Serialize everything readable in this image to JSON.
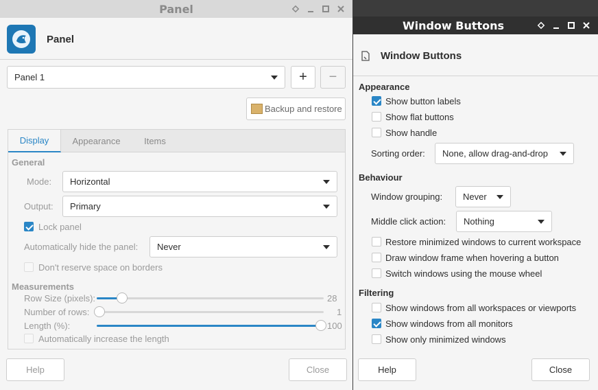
{
  "panel_window": {
    "title": "Panel",
    "header_title": "Panel",
    "panel_select": "Panel 1",
    "add_label": "+",
    "remove_label": "−",
    "backup_label": "Backup and restore",
    "tabs": [
      {
        "label": "Display",
        "active": true
      },
      {
        "label": "Appearance",
        "active": false
      },
      {
        "label": "Items",
        "active": false
      }
    ],
    "general": {
      "heading": "General",
      "mode_label": "Mode:",
      "mode_value": "Horizontal",
      "output_label": "Output:",
      "output_value": "Primary",
      "lock_panel": {
        "label": "Lock panel",
        "checked": true
      },
      "autohide_label": "Automatically hide the panel:",
      "autohide_value": "Never",
      "reserve_space": {
        "label": "Don't reserve space on borders",
        "checked": false
      }
    },
    "measurements": {
      "heading": "Measurements",
      "row_size_label": "Row Size (pixels):",
      "row_size_value": "28",
      "rows_label": "Number of rows:",
      "rows_value": "1",
      "length_label": "Length (%):",
      "length_value": "100",
      "auto_length": {
        "label": "Automatically increase the length",
        "checked": false
      }
    },
    "help_label": "Help",
    "close_label": "Close"
  },
  "wb_window": {
    "title": "Window Buttons",
    "header_title": "Window Buttons",
    "appearance": {
      "heading": "Appearance",
      "show_labels": {
        "label": "Show button labels",
        "checked": true
      },
      "flat_buttons": {
        "label": "Show flat buttons",
        "checked": false
      },
      "show_handle": {
        "label": "Show handle",
        "checked": false
      },
      "sorting_label": "Sorting order:",
      "sorting_value": "None, allow drag-and-drop"
    },
    "behaviour": {
      "heading": "Behaviour",
      "grouping_label": "Window grouping:",
      "grouping_value": "Never",
      "middle_label": "Middle click action:",
      "middle_value": "Nothing",
      "restore": {
        "label": "Restore minimized windows to current workspace",
        "checked": false
      },
      "draw_frame": {
        "label": "Draw window frame when hovering a button",
        "checked": false
      },
      "switch_wheel": {
        "label": "Switch windows using the mouse wheel",
        "checked": false
      }
    },
    "filtering": {
      "heading": "Filtering",
      "all_workspaces": {
        "label": "Show windows from all workspaces or viewports",
        "checked": false
      },
      "all_monitors": {
        "label": "Show windows from all monitors",
        "checked": true
      },
      "only_minimized": {
        "label": "Show only minimized windows",
        "checked": false
      }
    },
    "help_label": "Help",
    "close_label": "Close"
  },
  "colors": {
    "accent": "#2a86c6",
    "titlebar_dark": "#303030",
    "titlebar_inactive": "#d9d9d9"
  }
}
